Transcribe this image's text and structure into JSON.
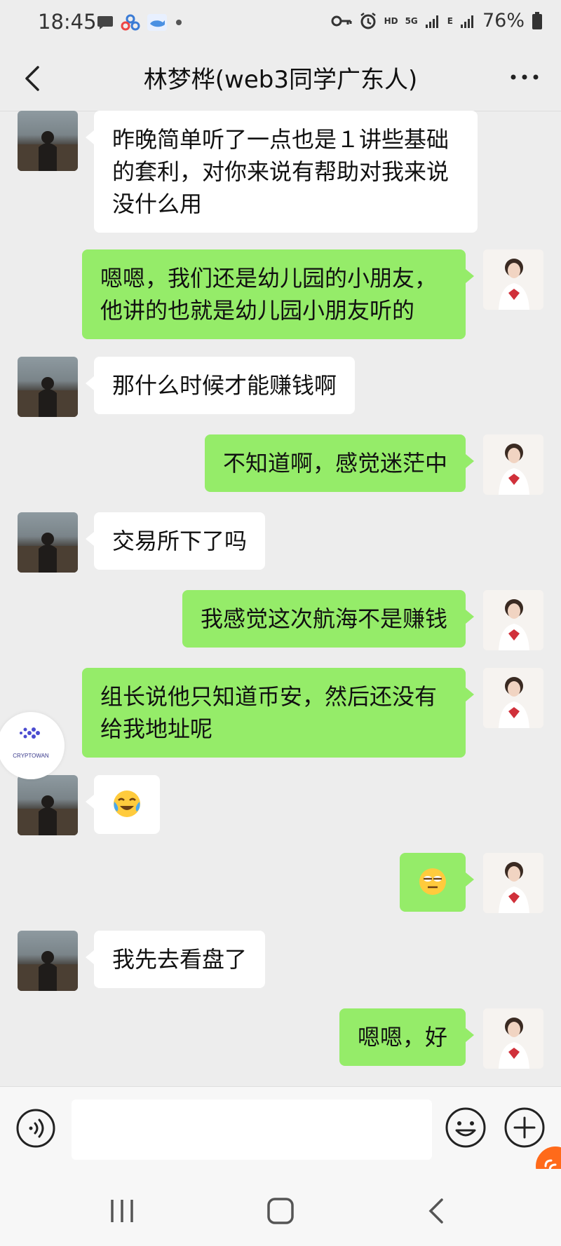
{
  "status_bar": {
    "time": "18:45",
    "network_hd": "HD",
    "network_5g": "5G",
    "network_e": "E",
    "battery_percent": "76%"
  },
  "header": {
    "title": "林梦桦(web3同学广东人)",
    "back_icon": "chevron-left-icon",
    "more_icon": "more-dots-icon"
  },
  "watermark": {
    "text": "CRYPTOWAN"
  },
  "messages": [
    {
      "side": "in",
      "text": "昨晚简单听了一点也是１讲些基础的套利，对你来说有帮助对我来说没什么用"
    },
    {
      "side": "out",
      "text": "嗯嗯，我们还是幼儿园的小朋友，他讲的也就是幼儿园小朋友听的"
    },
    {
      "side": "in",
      "text": "那什么时候才能赚钱啊"
    },
    {
      "side": "out",
      "text": "不知道啊，感觉迷茫中"
    },
    {
      "side": "in",
      "text": "交易所下了吗"
    },
    {
      "side": "out",
      "text": "我感觉这次航海不是赚钱"
    },
    {
      "side": "out",
      "text": "组长说他只知道币安，然后还没有给我地址呢"
    },
    {
      "side": "in",
      "emoji": "crying-laughing-emoji"
    },
    {
      "side": "out",
      "emoji": "unamused-face-emoji"
    },
    {
      "side": "in",
      "text": "我先去看盘了"
    },
    {
      "side": "out",
      "text": "嗯嗯，好"
    }
  ],
  "input_bar": {
    "voice_icon": "voice-icon",
    "emoji_icon": "smiley-icon",
    "plus_icon": "plus-icon",
    "placeholder": ""
  },
  "nav_bar": {
    "recent_icon": "recent-apps-icon",
    "home_icon": "home-icon",
    "back_icon": "nav-back-icon"
  },
  "colors": {
    "background": "#ededed",
    "bubble_out": "#95ec69",
    "bubble_in": "#ffffff",
    "float_badge": "#ff6a1a"
  }
}
